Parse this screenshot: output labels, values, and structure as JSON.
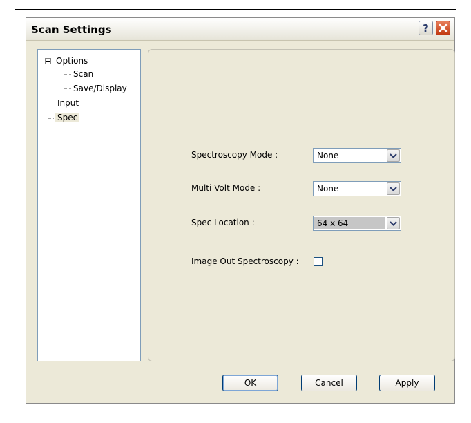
{
  "window": {
    "title": "Scan Settings"
  },
  "titlebar_buttons": {
    "help_label": "?"
  },
  "tree": {
    "options": "Options",
    "scan": "Scan",
    "save_display": "Save/Display",
    "input": "Input",
    "spec": "Spec"
  },
  "form": {
    "spectroscopy_mode": {
      "label": "Spectroscopy Mode :",
      "value": "None"
    },
    "multi_volt_mode": {
      "label": "Multi Volt Mode :",
      "value": "None"
    },
    "spec_location": {
      "label": "Spec Location :",
      "value": "64 x 64"
    },
    "image_out_spectroscopy": {
      "label": "Image Out Spectroscopy :",
      "checked": false
    }
  },
  "buttons": {
    "ok": "OK",
    "cancel": "Cancel",
    "apply": "Apply"
  },
  "icons": {
    "help": "question-mark",
    "close": "x-close",
    "dropdown": "chevron-down",
    "expander": "minus-box"
  },
  "colors": {
    "dialog_bg": "#ece9d8",
    "close_btn": "#c23a12",
    "border_blue": "#7f9db9"
  }
}
